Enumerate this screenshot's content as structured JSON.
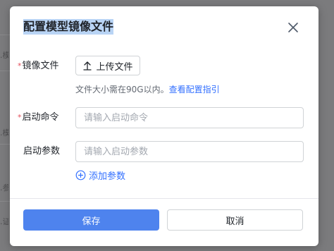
{
  "background": {
    "fragments": [
      ".模",
      ".模",
      ".参",
      ".证"
    ]
  },
  "dialog": {
    "title": "配置模型镜像文件",
    "close_icon": "close-icon",
    "fields": {
      "image_file": {
        "required_mark": "*",
        "label": "镜像文件",
        "upload_button_label": "上传文件",
        "upload_icon": "upload-icon",
        "hint_text": "文件大小需在90G以内。",
        "hint_link": "查看配置指引"
      },
      "start_command": {
        "required_mark": "*",
        "label": "启动命令",
        "value": "",
        "placeholder": "请输入启动命令"
      },
      "start_params": {
        "label": "启动参数",
        "value": "",
        "placeholder": "请输入启动参数"
      }
    },
    "add_param_label": "添加参数",
    "add_param_icon": "plus-circle-icon",
    "footer": {
      "save_label": "保存",
      "cancel_label": "取消"
    },
    "colors": {
      "primary": "#4e83ee",
      "link": "#3370ff",
      "required": "#e34d59",
      "title_highlight": "#b9d4f5"
    }
  }
}
